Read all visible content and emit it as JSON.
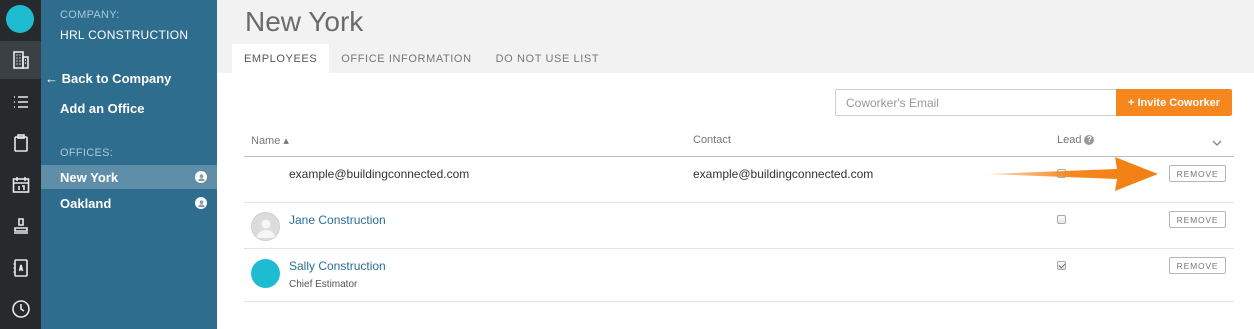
{
  "sidebar": {
    "company_label": "COMPANY:",
    "company_name": "HRL CONSTRUCTION",
    "back_link": "← Back to Company",
    "add_office": "Add an Office",
    "offices_label": "OFFICES:",
    "offices": [
      {
        "name": "New York",
        "selected": true
      },
      {
        "name": "Oakland",
        "selected": false
      }
    ]
  },
  "rail_icons": [
    "building-icon",
    "list-icon",
    "clipboard-icon",
    "calendar-icon",
    "stamp-icon",
    "address-book-icon",
    "clock-icon"
  ],
  "page": {
    "title": "New York",
    "tabs": [
      {
        "label": "EMPLOYEES",
        "active": true
      },
      {
        "label": "OFFICE INFORMATION",
        "active": false
      },
      {
        "label": "DO NOT USE LIST",
        "active": false
      }
    ]
  },
  "invite": {
    "placeholder": "Coworker's Email",
    "button": "+ Invite Coworker"
  },
  "table": {
    "columns": {
      "name": "Name ▴",
      "contact": "Contact",
      "lead": "Lead"
    },
    "rows": [
      {
        "name": "example@buildingconnected.com",
        "subtitle": "",
        "contact": "example@buildingconnected.com",
        "lead": false,
        "avatar": "none",
        "action": "REMOVE"
      },
      {
        "name": "Jane Construction",
        "subtitle": "",
        "contact": "",
        "lead": false,
        "avatar": "placeholder",
        "action": "REMOVE"
      },
      {
        "name": "Sally Construction",
        "subtitle": "Chief Estimator",
        "contact": "",
        "lead": true,
        "avatar": "teal",
        "action": "REMOVE"
      }
    ]
  },
  "colors": {
    "sidebar": "#2e6d8e",
    "rail": "#262a2d",
    "accent_orange": "#f6871f",
    "teal": "#1ebcd0",
    "link": "#2a6f98"
  }
}
